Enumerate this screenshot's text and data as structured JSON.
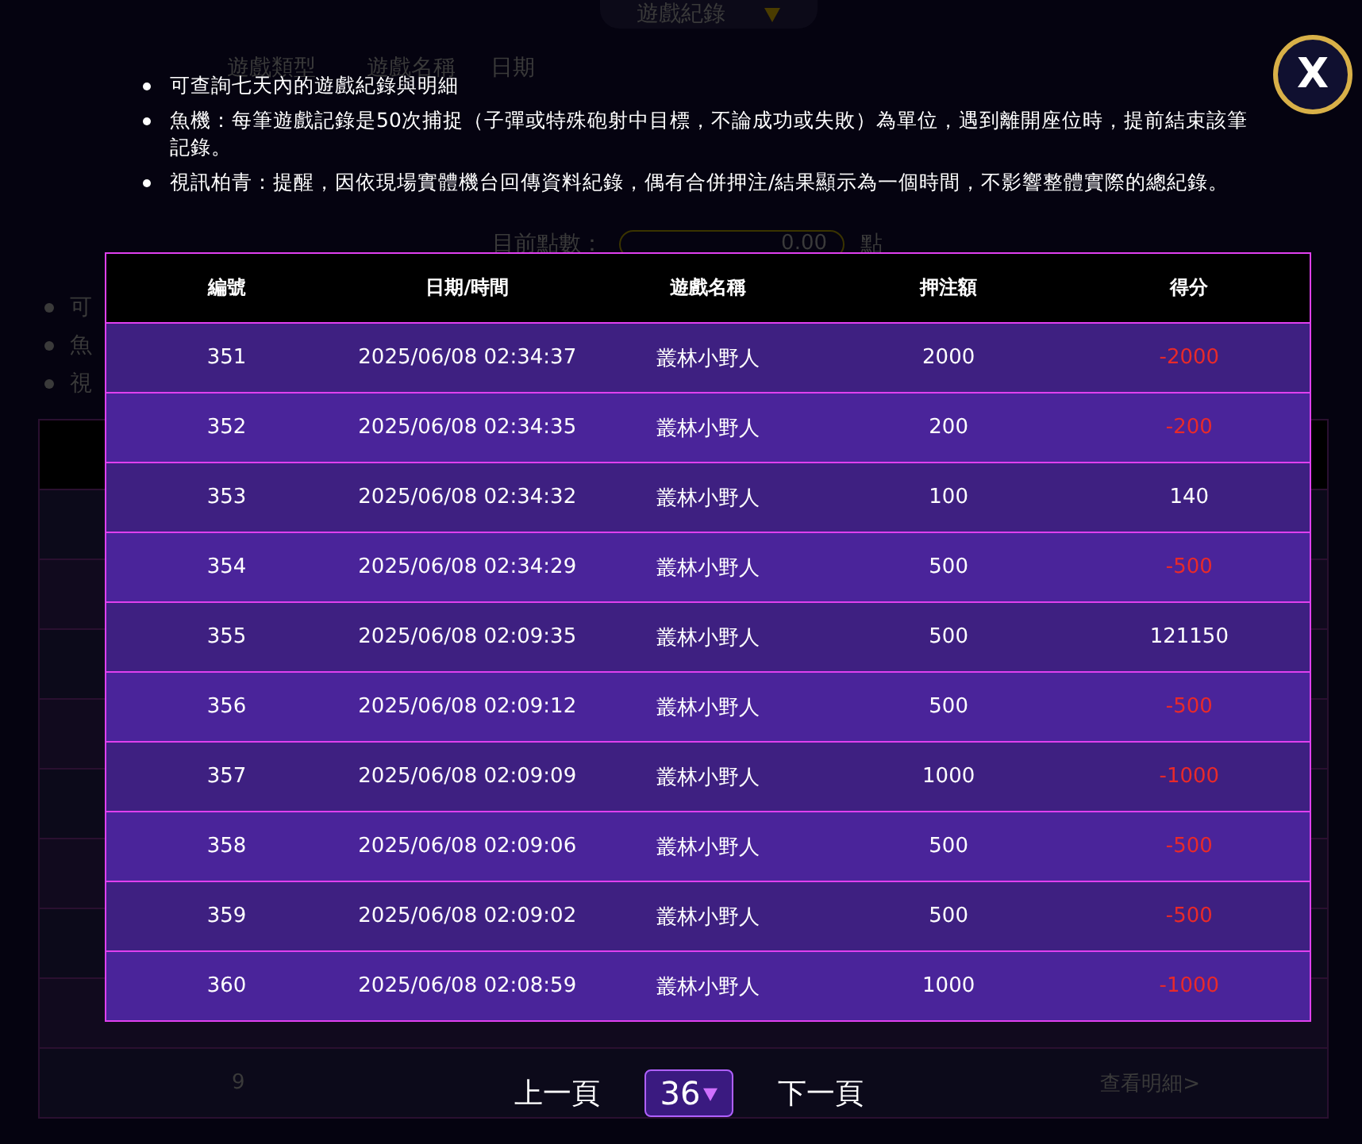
{
  "page": {
    "record_dropdown": "遊戲紀錄",
    "filter_labels": [
      "遊戲類型",
      "遊戲名稱",
      "日期"
    ],
    "points": {
      "label": "目前點數：",
      "value": "0.00",
      "unit": "點"
    },
    "notes": [
      "可",
      "魚",
      "視"
    ],
    "table_rows": [
      {
        "no": "9",
        "action": "查看明細>"
      }
    ]
  },
  "dialog": {
    "close": "X",
    "notes": [
      "可查詢七天內的遊戲紀錄與明細",
      "魚機：每筆遊戲記錄是50次捕捉（子彈或特殊砲射中目標，不論成功或失敗）為單位，遇到離開座位時，提前結束該筆記錄。",
      "視訊柏青：提醒，因依現場實體機台回傳資料紀錄，偶有合併押注/結果顯示為一個時間，不影響整體實際的總紀錄。"
    ],
    "columns": [
      "編號",
      "日期/時間",
      "遊戲名稱",
      "押注額",
      "得分"
    ],
    "rows": [
      {
        "no": "351",
        "time": "2025/06/08 02:34:37",
        "game": "叢林小野人",
        "bet": "2000",
        "score": "-2000",
        "negative": true
      },
      {
        "no": "352",
        "time": "2025/06/08 02:34:35",
        "game": "叢林小野人",
        "bet": "200",
        "score": "-200",
        "negative": true
      },
      {
        "no": "353",
        "time": "2025/06/08 02:34:32",
        "game": "叢林小野人",
        "bet": "100",
        "score": "140",
        "negative": false
      },
      {
        "no": "354",
        "time": "2025/06/08 02:34:29",
        "game": "叢林小野人",
        "bet": "500",
        "score": "-500",
        "negative": true
      },
      {
        "no": "355",
        "time": "2025/06/08 02:09:35",
        "game": "叢林小野人",
        "bet": "500",
        "score": "121150",
        "negative": false
      },
      {
        "no": "356",
        "time": "2025/06/08 02:09:12",
        "game": "叢林小野人",
        "bet": "500",
        "score": "-500",
        "negative": true
      },
      {
        "no": "357",
        "time": "2025/06/08 02:09:09",
        "game": "叢林小野人",
        "bet": "1000",
        "score": "-1000",
        "negative": true
      },
      {
        "no": "358",
        "time": "2025/06/08 02:09:06",
        "game": "叢林小野人",
        "bet": "500",
        "score": "-500",
        "negative": true
      },
      {
        "no": "359",
        "time": "2025/06/08 02:09:02",
        "game": "叢林小野人",
        "bet": "500",
        "score": "-500",
        "negative": true
      },
      {
        "no": "360",
        "time": "2025/06/08 02:08:59",
        "game": "叢林小野人",
        "bet": "1000",
        "score": "-1000",
        "negative": true
      }
    ],
    "pagination": {
      "previous": "上一頁",
      "page": "36",
      "next": "下一頁"
    }
  }
}
